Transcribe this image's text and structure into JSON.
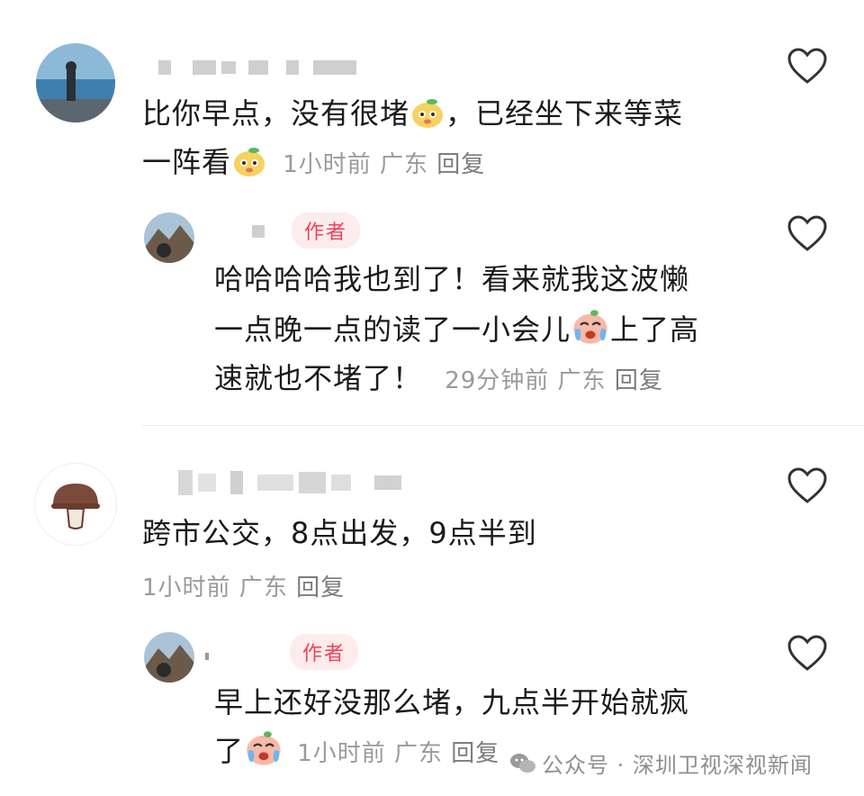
{
  "comments": [
    {
      "text_line1": "比你早点，没有很堵",
      "text_line1_tail": "，已经坐下来等菜",
      "text_line2": "一阵看",
      "time": "1小时前",
      "region": "广东",
      "reply": "回复",
      "emoji": "yellow-pear-emoji"
    },
    {
      "badge": "作者",
      "text_line1": "哈哈哈哈我也到了！看来就我这波懒",
      "text_line2": "一点晚一点的读了一小会儿",
      "text_line2_tail": "上了高",
      "text_line3": "速就也不堵了！",
      "time": "29分钟前",
      "region": "广东",
      "reply": "回复",
      "emoji": "crying-face-emoji"
    },
    {
      "text_line1": "跨市公交，8点出发，9点半到",
      "time": "1小时前",
      "region": "广东",
      "reply": "回复"
    },
    {
      "badge": "作者",
      "text_line1": "早上还好没那么堵，九点半开始就疯",
      "text_line2": "了",
      "time": "1小时前",
      "region": "广东",
      "reply": "回复",
      "emoji": "crying-face-emoji"
    }
  ],
  "watermark": "公众号 · 深圳卫视深视新闻",
  "colors": {
    "badge_bg": "#fdecec",
    "badge_text": "#f0405a",
    "meta": "#9a9a9a"
  }
}
